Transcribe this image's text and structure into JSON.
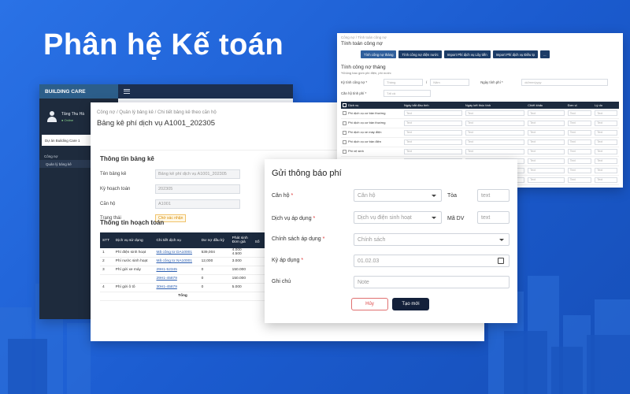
{
  "headline": "Phân hệ Kế toán",
  "app": {
    "brand": "BUILDING CARE",
    "user_name": "Tăng Thu Hà",
    "user_status": "● Online",
    "project_select": "Dự án Building Care 1",
    "menu": [
      "Công nợ",
      "Quản lý bảng kê"
    ]
  },
  "statement": {
    "breadcrumb": "Công nợ  /  Quản lý bảng kê  /  Chi tiết bảng kê theo căn hộ",
    "title": "Bảng kê phí dịch vụ A1001_202305",
    "info_heading": "Thông tin bảng kê",
    "fields": [
      {
        "label": "Tên bảng kê",
        "value": "Bảng kê phí dịch vụ A1001_202305"
      },
      {
        "label": "Kỳ hoạch toán",
        "value": "202305"
      },
      {
        "label": "Căn hộ",
        "value": "A1001"
      }
    ],
    "status_label": "Trạng thái",
    "status_value": "Chờ xác nhận",
    "accounting_heading": "Thông tin hoạch toán",
    "table": {
      "headers": [
        "STT",
        "Dịch vụ sử dụng",
        "Chi tiết dịch vụ",
        "Dư nợ đầu kỳ",
        "Phát sinh"
      ],
      "sub_headers": [
        "Đơn giá",
        "Số"
      ],
      "rows": [
        {
          "stt": "1",
          "service": "Phí điện sinh hoạt",
          "detail": "Mã công tơ DA10001",
          "opening": "539,004",
          "price": "4.000",
          "price2": "4.500"
        },
        {
          "stt": "2",
          "service": "Phí nước sinh hoạt",
          "detail": "Mã công tơ NA10001",
          "opening": "12,000",
          "price": "3.000",
          "price2": ""
        },
        {
          "stt": "3",
          "service": "Phí gửi xe máy",
          "detail": "29H1-52345",
          "opening": "0",
          "price": "150.000",
          "price2": ""
        },
        {
          "stt": "",
          "service": "",
          "detail": "29H1-45879",
          "opening": "0",
          "price": "150.000",
          "price2": ""
        },
        {
          "stt": "4",
          "service": "Phí gửi ô tô",
          "detail": "30H1-45879",
          "opening": "0",
          "price": "5.000",
          "price2": ""
        }
      ],
      "total_label": "Tổng"
    }
  },
  "debt": {
    "breadcrumb": "Công nợ  /  Tính toán công nợ",
    "title": "Tính toán công nợ",
    "tabs": [
      "Tính công nợ tháng",
      "Tính công nợ điện nước",
      "Import Phí dịch vụ Lũy tiến",
      "Import Phí dịch vụ Điều tọ",
      "..."
    ],
    "panel_heading": "Tính công nợ tháng",
    "panel_note": "*Không bao gồm phí điện, phí nước",
    "period_label": "Kỳ tính công nợ *",
    "month_ph": "Tháng",
    "year_ph": "Năm",
    "date_label": "Ngày tính phí *",
    "date_ph": "dd/mm/yyyy",
    "fee_label": "Căn hộ tính phí *",
    "fee_ph": "Tất cả",
    "table_headers": [
      "Dịch vụ",
      "Ngày bắt đầu tính",
      "Ngày kết thúc tính",
      "Chiết khấu",
      "Đơn vị",
      "Lý do"
    ],
    "rows": [
      "Phí dịch vụ cơ bản thường",
      "Phí dịch vụ cơ bản thường",
      "Phí dịch vụ xe máy điện",
      "Phí dịch vụ cơ bản điện",
      "Phí vệ sinh",
      "Phí CSPT",
      "Phí dịch vụ",
      "Phí khác"
    ],
    "cell_ph": "Text",
    "unit_ph": "Text"
  },
  "modal": {
    "title": "Gửi thông báo phí",
    "fields": {
      "apartment_label": "Căn hộ",
      "apartment_ph": "Căn hộ",
      "building_label": "Tòa",
      "building_ph": "text",
      "service_label": "Dịch vụ áp dụng",
      "service_value": "Dịch vụ điện sinh hoạt",
      "code_label": "Mã DV",
      "code_ph": "text",
      "policy_label": "Chính sách áp dụng",
      "policy_ph": "Chính sách",
      "period_label": "Kỳ áp dụng",
      "period_value": "01.02.03",
      "note_label": "Ghi chú",
      "note_ph": "Note"
    },
    "required_mark": "*",
    "cancel_label": "Hủy",
    "create_label": "Tạo mới"
  }
}
